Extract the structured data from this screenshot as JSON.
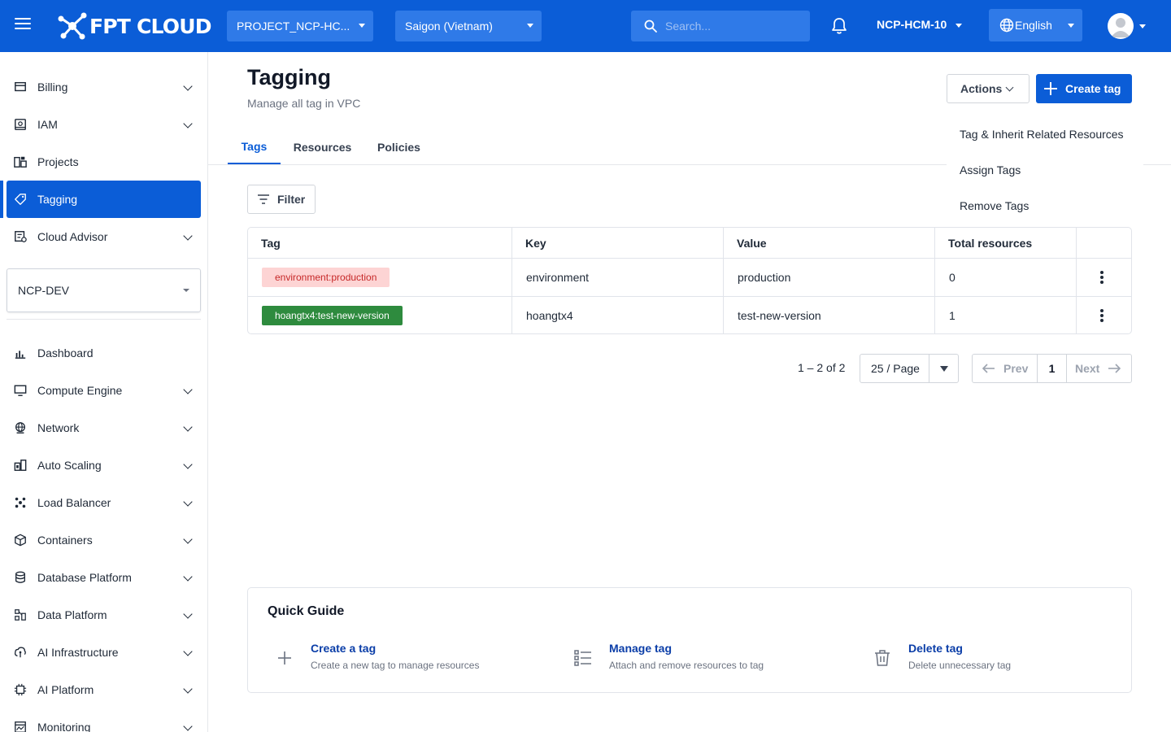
{
  "topbar": {
    "logo_text": "FPT CLOUD",
    "project_select": "PROJECT_NCP-HC...",
    "region_select": "Saigon (Vietnam)",
    "search_placeholder": "Search...",
    "region_label": "NCP-HCM-10",
    "language": "English",
    "brand_color": "#0b5dd7"
  },
  "sidebar": {
    "items_top": [
      {
        "label": "Billing",
        "icon": "billing-icon",
        "expandable": true
      },
      {
        "label": "IAM",
        "icon": "iam-icon",
        "expandable": true
      },
      {
        "label": "Projects",
        "icon": "projects-icon",
        "expandable": false
      },
      {
        "label": "Tagging",
        "icon": "tag-icon",
        "expandable": false,
        "active": true
      },
      {
        "label": "Cloud Advisor",
        "icon": "cloud-advisor-icon",
        "expandable": true
      }
    ],
    "project_selector": "NCP-DEV",
    "items_bottom": [
      {
        "label": "Dashboard",
        "icon": "dashboard-icon",
        "expandable": false
      },
      {
        "label": "Compute Engine",
        "icon": "monitor-icon",
        "expandable": true
      },
      {
        "label": "Network",
        "icon": "globe-icon",
        "expandable": true
      },
      {
        "label": "Auto Scaling",
        "icon": "auto-scaling-icon",
        "expandable": true
      },
      {
        "label": "Load Balancer",
        "icon": "load-balancer-icon",
        "expandable": true
      },
      {
        "label": "Containers",
        "icon": "cube-icon",
        "expandable": true
      },
      {
        "label": "Database Platform",
        "icon": "database-icon",
        "expandable": true
      },
      {
        "label": "Data Platform",
        "icon": "data-platform-icon",
        "expandable": true
      },
      {
        "label": "AI Infrastructure",
        "icon": "ai-infra-icon",
        "expandable": true
      },
      {
        "label": "AI Platform",
        "icon": "chip-icon",
        "expandable": true
      },
      {
        "label": "Monitoring",
        "icon": "monitoring-icon",
        "expandable": true
      }
    ]
  },
  "page": {
    "title": "Tagging",
    "subtitle": "Manage all tag in VPC",
    "actions_label": "Actions",
    "create_label": "Create tag",
    "tabs": [
      "Tags",
      "Resources",
      "Policies"
    ],
    "active_tab": "Tags",
    "actions_menu": [
      "Tag & Inherit Related Resources",
      "Assign Tags",
      "Remove Tags"
    ],
    "filter_label": "Filter"
  },
  "table": {
    "columns": [
      "Tag",
      "Key",
      "Value",
      "Total resources"
    ],
    "rows": [
      {
        "tag": "environment:production",
        "tag_color": "#fdd4d4",
        "key": "environment",
        "value": "production",
        "total": "0"
      },
      {
        "tag": "hoangtx4:test-new-version",
        "tag_color": "#2e8b3e",
        "key": "hoangtx4",
        "value": "test-new-version",
        "total": "1"
      }
    ]
  },
  "pagination": {
    "summary": "1 – 2 of 2",
    "page_size": "25 / Page",
    "prev": "Prev",
    "current": "1",
    "next": "Next"
  },
  "guide": {
    "title": "Quick Guide",
    "items": [
      {
        "title": "Create a tag",
        "desc": "Create a new tag to manage resources",
        "icon": "plus-icon"
      },
      {
        "title": "Manage tag",
        "desc": "Attach and remove resources to tag",
        "icon": "list-icon"
      },
      {
        "title": "Delete tag",
        "desc": "Delete unnecessary tag",
        "icon": "trash-icon"
      }
    ]
  }
}
